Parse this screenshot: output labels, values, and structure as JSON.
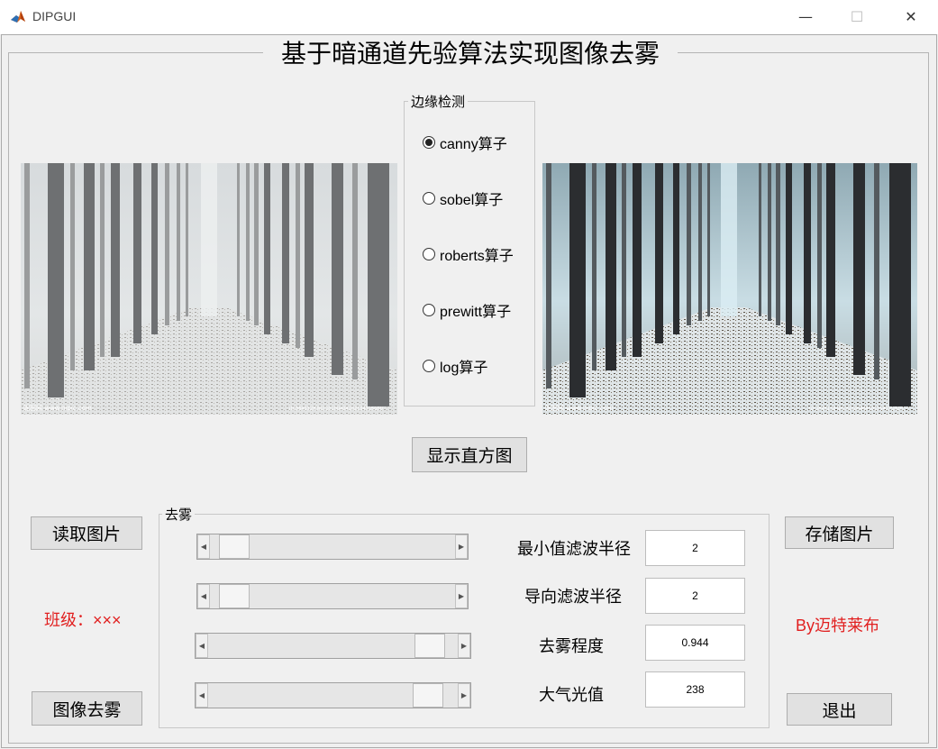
{
  "window": {
    "title": "DIPGUI",
    "minimize": "—",
    "maximize": "☐",
    "close": "✕"
  },
  "main_title": "基于暗通道先验算法实现图像去雾",
  "images": {
    "left": {
      "watermark_left": "昵图网 www.nipic.com",
      "watermark_right": "ID:3845128 NO:20100404102154725000"
    },
    "right": {
      "watermark_left": "昵图网 www.nipic.com",
      "watermark_right": "ID:3845128 NO:20100404102154725000"
    }
  },
  "edge_detection": {
    "title": "边缘检测",
    "options": [
      {
        "label": "canny算子",
        "checked": true
      },
      {
        "label": "sobel算子",
        "checked": false
      },
      {
        "label": "roberts算子",
        "checked": false
      },
      {
        "label": "prewitt算子",
        "checked": false
      },
      {
        "label": "log算子",
        "checked": false
      }
    ]
  },
  "buttons": {
    "histogram": "显示直方图",
    "read_image": "读取图片",
    "save_image": "存储图片",
    "dehaze": "图像去雾",
    "exit": "退出"
  },
  "class_label": "班级：×××",
  "author_label": "By迈特莱布",
  "dehaze_panel": {
    "title": "去雾",
    "params": [
      {
        "label": "最小值滤波半径",
        "value": "2",
        "slider_fraction": 0.04
      },
      {
        "label": "导向滤波半径",
        "value": "2",
        "slider_fraction": 0.04
      },
      {
        "label": "去雾程度",
        "value": "0.944",
        "slider_fraction": 0.944
      },
      {
        "label": "大气光值",
        "value": "238",
        "slider_fraction": 0.933
      }
    ]
  },
  "colors": {
    "label_red": "#e11f1f",
    "panel_bg": "#f0f0f0"
  },
  "icons": {
    "app": "matlab-icon",
    "radio_selected": "radio-checked-icon"
  }
}
